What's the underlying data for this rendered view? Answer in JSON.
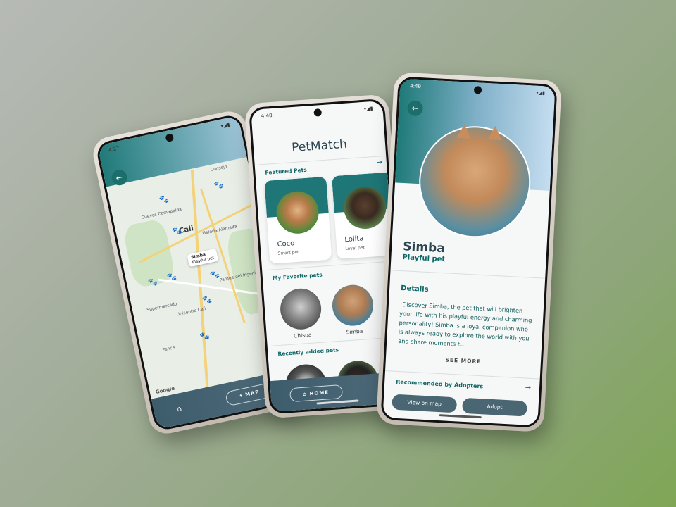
{
  "map_phone": {
    "status_time": "4:27",
    "back_icon": "arrow-left-icon",
    "city_label": "Cali",
    "tooltip_name": "Simba",
    "tooltip_sub": "Playful pet",
    "place_labels": [
      "Consejo",
      "Cuevas Camapalda",
      "Galería Alameda",
      "Parque del Ingenio",
      "Unicentro Cali",
      "Supermercado",
      "Pance"
    ],
    "google_label": "Google",
    "nav_map_label": "MAP",
    "nav_home_icon": "home-icon",
    "nav_map_icon": "map-pin-icon"
  },
  "home_phone": {
    "status_time": "4:48",
    "app_title": "PetMatch",
    "featured_title": "Featured Pets",
    "featured_pets": [
      {
        "name": "Coco",
        "sub": "Smart pet"
      },
      {
        "name": "Lolita",
        "sub": "Loyal pet"
      }
    ],
    "favorites_title": "My Favorite pets",
    "favorites": [
      {
        "name": "Chispa"
      },
      {
        "name": "Simba"
      }
    ],
    "recent_title": "Recently added pets",
    "nav_home_label": "HOME",
    "arrow_icon": "arrow-right-icon"
  },
  "detail_phone": {
    "status_time": "4:49",
    "pet_name": "Simba",
    "pet_sub": "Playful pet",
    "details_title": "Details",
    "details_text": "¡Discover Simba, the pet that will brighten your life with his playful energy and charming personality! Simba is a loyal companion who is always ready to explore the world with you and share moments f...",
    "see_more_label": "SEE MORE",
    "recommended_title": "Recommended by Adopters",
    "view_map_label": "View on map",
    "adopt_label": "Adopt"
  }
}
